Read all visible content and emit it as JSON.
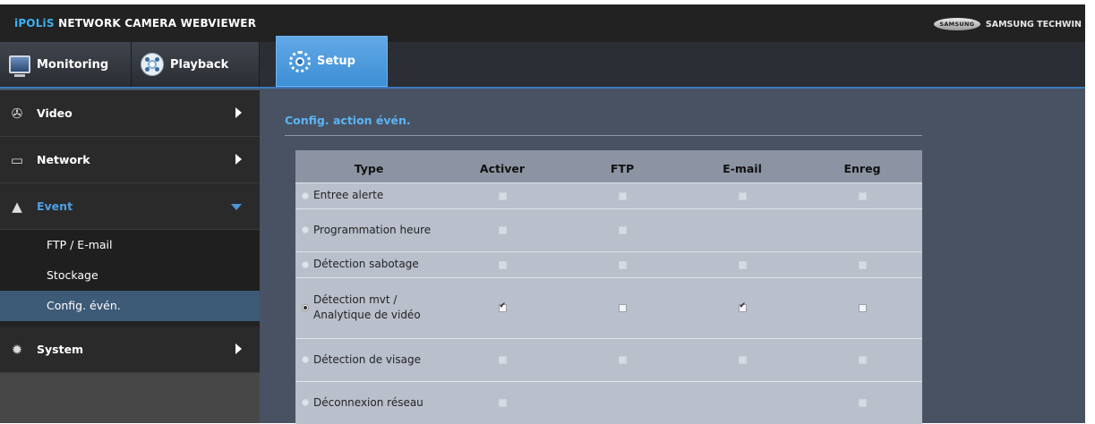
{
  "header": {
    "title_prefix": "iPOLiS",
    "title_rest": " NETWORK CAMERA WEBVIEWER",
    "brand_logo": "SAMSUNG",
    "brand_name": "SAMSUNG TECHWIN"
  },
  "nav": {
    "tabs": [
      {
        "label": "Monitoring",
        "icon": "monitor-icon"
      },
      {
        "label": "Playback",
        "icon": "film-reel-icon"
      },
      {
        "label": "Setup",
        "icon": "gear-icon",
        "active": true
      }
    ]
  },
  "sidebar": {
    "items": [
      {
        "label": "Video",
        "icon": "video-icon"
      },
      {
        "label": "Network",
        "icon": "network-icon"
      },
      {
        "label": "Event",
        "icon": "event-bell-icon",
        "expanded": true
      },
      {
        "label": "System",
        "icon": "system-gear-icon"
      }
    ],
    "event_subitems": [
      {
        "label": "FTP / E-mail"
      },
      {
        "label": "Stockage"
      },
      {
        "label": "Config. évén.",
        "active": true
      }
    ]
  },
  "main": {
    "section_title": "Config. action évén.",
    "table": {
      "headers": [
        "Type",
        "Activer",
        "FTP",
        "E-mail",
        "Enreg"
      ],
      "rows": [
        {
          "type": "Entree alerte",
          "selected": false,
          "activer": "disabled",
          "ftp": "disabled",
          "email": "disabled",
          "enreg": "disabled"
        },
        {
          "type": "Programmation heure",
          "selected": false,
          "activer": "disabled",
          "ftp": "disabled",
          "email": "none",
          "enreg": "none"
        },
        {
          "type": "Détection sabotage",
          "selected": false,
          "activer": "disabled",
          "ftp": "disabled",
          "email": "disabled",
          "enreg": "disabled"
        },
        {
          "type": "Détection mvt / Analytique de vidéo",
          "selected": true,
          "activer": "checked",
          "ftp": "unchecked",
          "email": "checked",
          "enreg": "unchecked"
        },
        {
          "type": "Détection de visage",
          "selected": false,
          "activer": "disabled",
          "ftp": "disabled",
          "email": "disabled",
          "enreg": "disabled"
        },
        {
          "type": "Déconnexion réseau",
          "selected": false,
          "activer": "disabled",
          "ftp": "none",
          "email": "none",
          "enreg": "disabled"
        }
      ]
    }
  },
  "colors": {
    "accent": "#3db1f2",
    "setup_tab": "#4a97da",
    "content_bg": "#485263",
    "table_bg": "#b9bfcb"
  }
}
